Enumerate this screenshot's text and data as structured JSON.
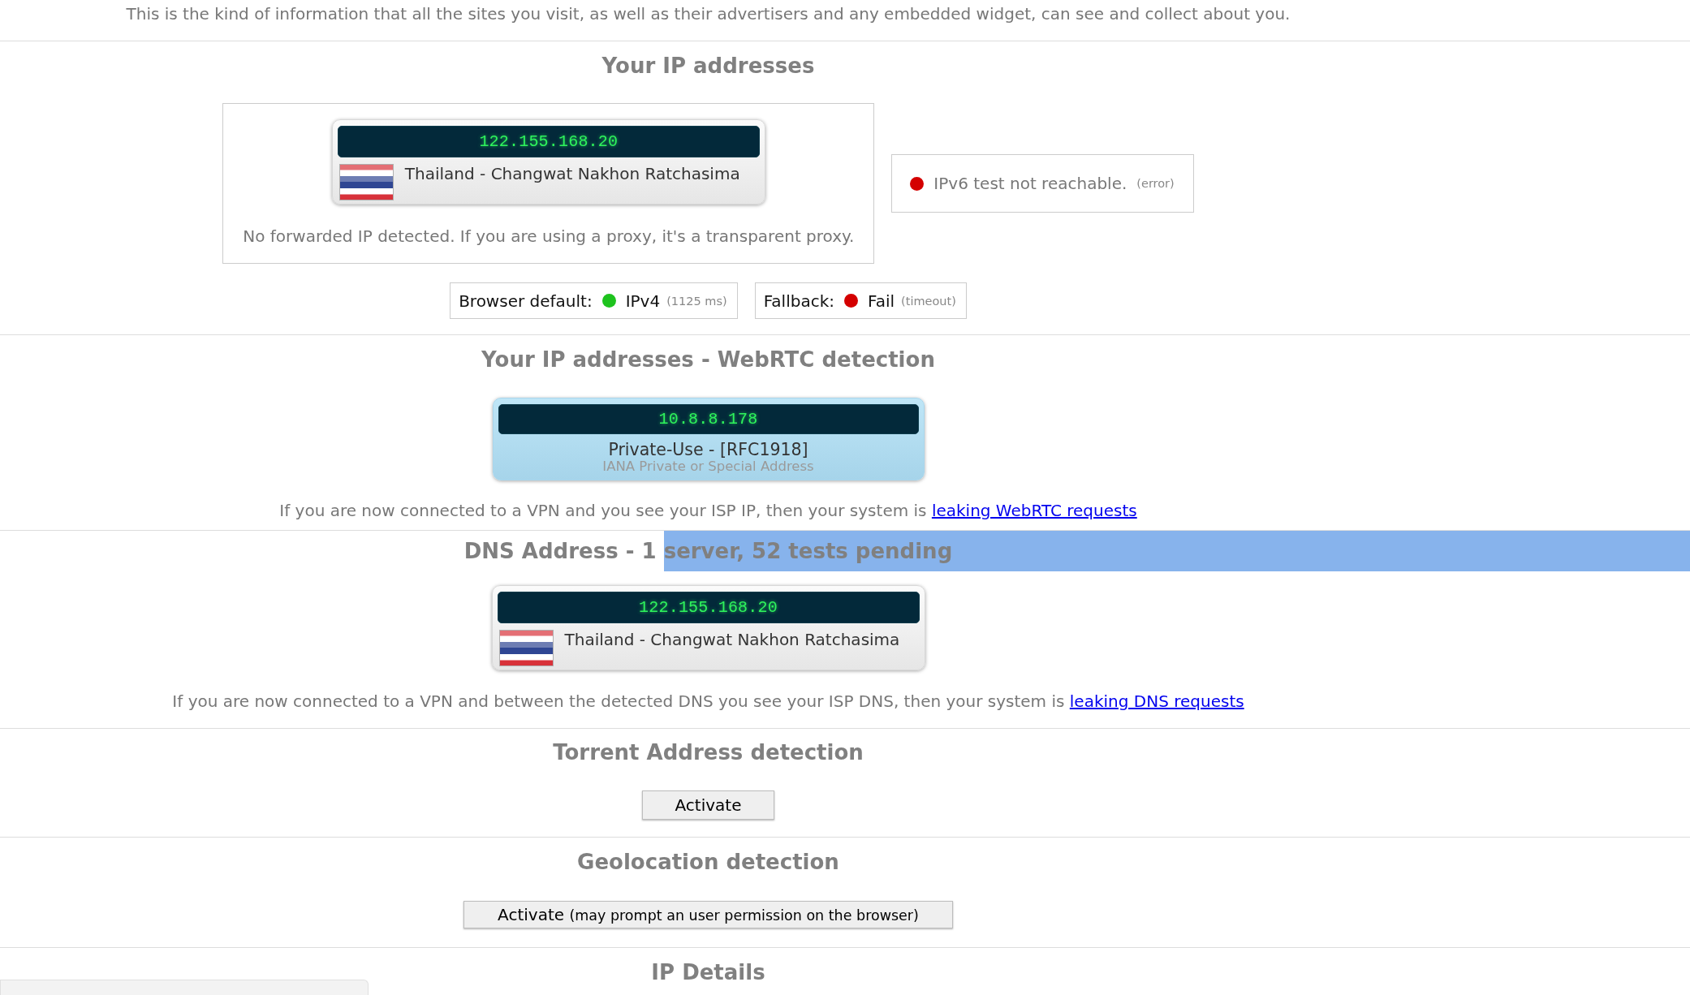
{
  "intro": "This is the kind of information that all the sites you visit, as well as their advertisers and any embedded widget, can see and collect about you.",
  "ip_section": {
    "title": "Your IP addresses",
    "ipv4": {
      "ip": "122.155.168.20",
      "location": "Thailand - Changwat Nakhon Ratchasima",
      "note": "No forwarded IP detected. If you are using a proxy, it's a transparent proxy."
    },
    "ipv6": {
      "color": "#d40000",
      "text": "IPv6 test not reachable.",
      "detail": "(error)"
    },
    "checks": [
      {
        "label": "Browser default:",
        "color": "#1ec31e",
        "value": "IPv4",
        "detail": "(1125 ms)"
      },
      {
        "label": "Fallback:",
        "color": "#d40000",
        "value": "Fail",
        "detail": "(timeout)"
      }
    ]
  },
  "webrtc_section": {
    "title": "Your IP addresses - WebRTC detection",
    "address": {
      "ip": "10.8.8.178",
      "name": "Private-Use - [RFC1918]",
      "description": "IANA Private or Special Address"
    },
    "note": {
      "text": "If you are now connected to a VPN and you see your ISP IP, then your system is",
      "link": "leaking WebRTC requests"
    }
  },
  "dns_section": {
    "title": [
      {
        "text": "DNS Address - 1 ",
        "selected": false
      },
      {
        "text": "server, 52 tests pending",
        "selected": true
      }
    ],
    "servers": [
      {
        "ip": "122.155.168.20",
        "location": "Thailand - Changwat Nakhon Ratchasima"
      }
    ],
    "note": {
      "text": "If you are now connected to a VPN and between the detected DNS you see your ISP DNS, then your system is",
      "link": "leaking DNS requests"
    }
  },
  "torrent_section": {
    "title": "Torrent Address detection",
    "button": {
      "label": "Activate"
    }
  },
  "geo_section": {
    "title": "Geolocation detection",
    "button": {
      "label": "Activate",
      "note": "(may prompt an user permission on the browser)"
    }
  },
  "details_section": {
    "title": "IP Details"
  }
}
